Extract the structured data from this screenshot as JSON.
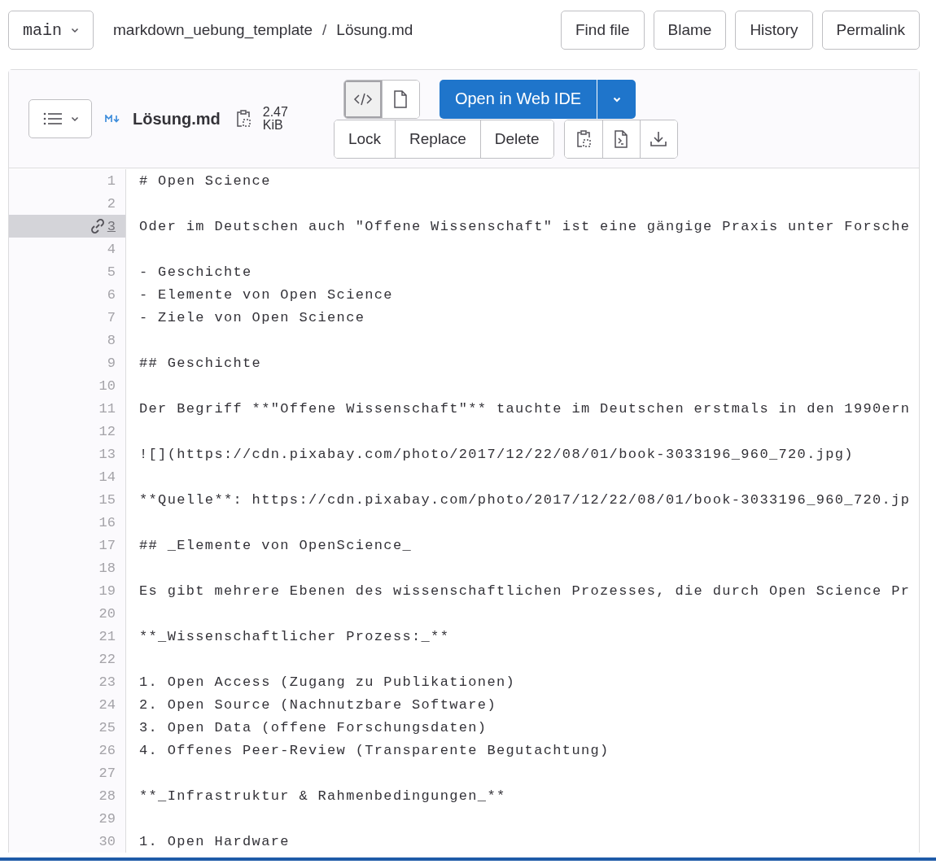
{
  "branch": {
    "label": "main"
  },
  "breadcrumb": [
    {
      "label": "markdown_uebung_template"
    },
    {
      "label": "Lösung.md"
    }
  ],
  "breadcrumb_separator": "/",
  "top_actions": [
    {
      "label": "Find file"
    },
    {
      "label": "Blame"
    },
    {
      "label": "History"
    },
    {
      "label": "Permalink"
    }
  ],
  "file": {
    "name": "Lösung.md",
    "size_value": "2.47",
    "size_unit": "KiB"
  },
  "view_toggle": [
    {
      "kind": "source",
      "selected": true
    },
    {
      "kind": "rendered",
      "selected": false
    }
  ],
  "open_button": "Open in Web IDE",
  "file_actions": [
    {
      "label": "Lock"
    },
    {
      "label": "Replace"
    },
    {
      "label": "Delete"
    }
  ],
  "lines": [
    {
      "number": "1",
      "text": "# Open Science",
      "selected": false
    },
    {
      "number": "2",
      "selected": false
    },
    {
      "number": "3",
      "text": "Oder im Deutschen auch \"Offene Wissenschaft\" ist eine gängige Praxis unter Forsche",
      "selected": true
    },
    {
      "number": "4",
      "selected": false
    },
    {
      "number": "5",
      "text": "- Geschichte",
      "selected": false
    },
    {
      "number": "6",
      "text": "- Elemente von Open Science",
      "selected": false
    },
    {
      "number": "7",
      "text": "- Ziele von Open Science",
      "selected": false
    },
    {
      "number": "8",
      "selected": false
    },
    {
      "number": "9",
      "text": "## Geschichte",
      "selected": false
    },
    {
      "number": "10",
      "selected": false
    },
    {
      "number": "11",
      "text": "Der Begriff **\"Offene Wissenschaft\"** tauchte im Deutschen erstmals in den 1990ern",
      "selected": false
    },
    {
      "number": "12",
      "selected": false
    },
    {
      "number": "13",
      "text": "![](https://cdn.pixabay.com/photo/2017/12/22/08/01/book-3033196_960_720.jpg)",
      "selected": false
    },
    {
      "number": "14",
      "selected": false
    },
    {
      "number": "15",
      "text": "**Quelle**: https://cdn.pixabay.com/photo/2017/12/22/08/01/book-3033196_960_720.jp",
      "selected": false
    },
    {
      "number": "16",
      "selected": false
    },
    {
      "number": "17",
      "text": "## _Elemente von OpenScience_",
      "selected": false
    },
    {
      "number": "18",
      "selected": false
    },
    {
      "number": "19",
      "text": "Es gibt mehrere Ebenen des wissenschaftlichen Prozesses, die durch Open Science Pr",
      "selected": false
    },
    {
      "number": "20",
      "selected": false
    },
    {
      "number": "21",
      "text": "**_Wissenschaftlicher Prozess:_**",
      "selected": false
    },
    {
      "number": "22",
      "selected": false
    },
    {
      "number": "23",
      "text": "1. Open Access (Zugang zu Publikationen)",
      "selected": false
    },
    {
      "number": "24",
      "text": "2. Open Source (Nachnutzbare Software)",
      "selected": false
    },
    {
      "number": "25",
      "text": "3. Open Data (offene Forschungsdaten)",
      "selected": false
    },
    {
      "number": "26",
      "text": "4. Offenes Peer-Review (Transparente Begutachtung)",
      "selected": false
    },
    {
      "number": "27",
      "selected": false
    },
    {
      "number": "28",
      "text": "**_Infrastruktur & Rahmenbedingungen_**",
      "selected": false
    },
    {
      "number": "29",
      "selected": false
    },
    {
      "number": "30",
      "text": "1. Open Hardware",
      "selected": false
    }
  ]
}
